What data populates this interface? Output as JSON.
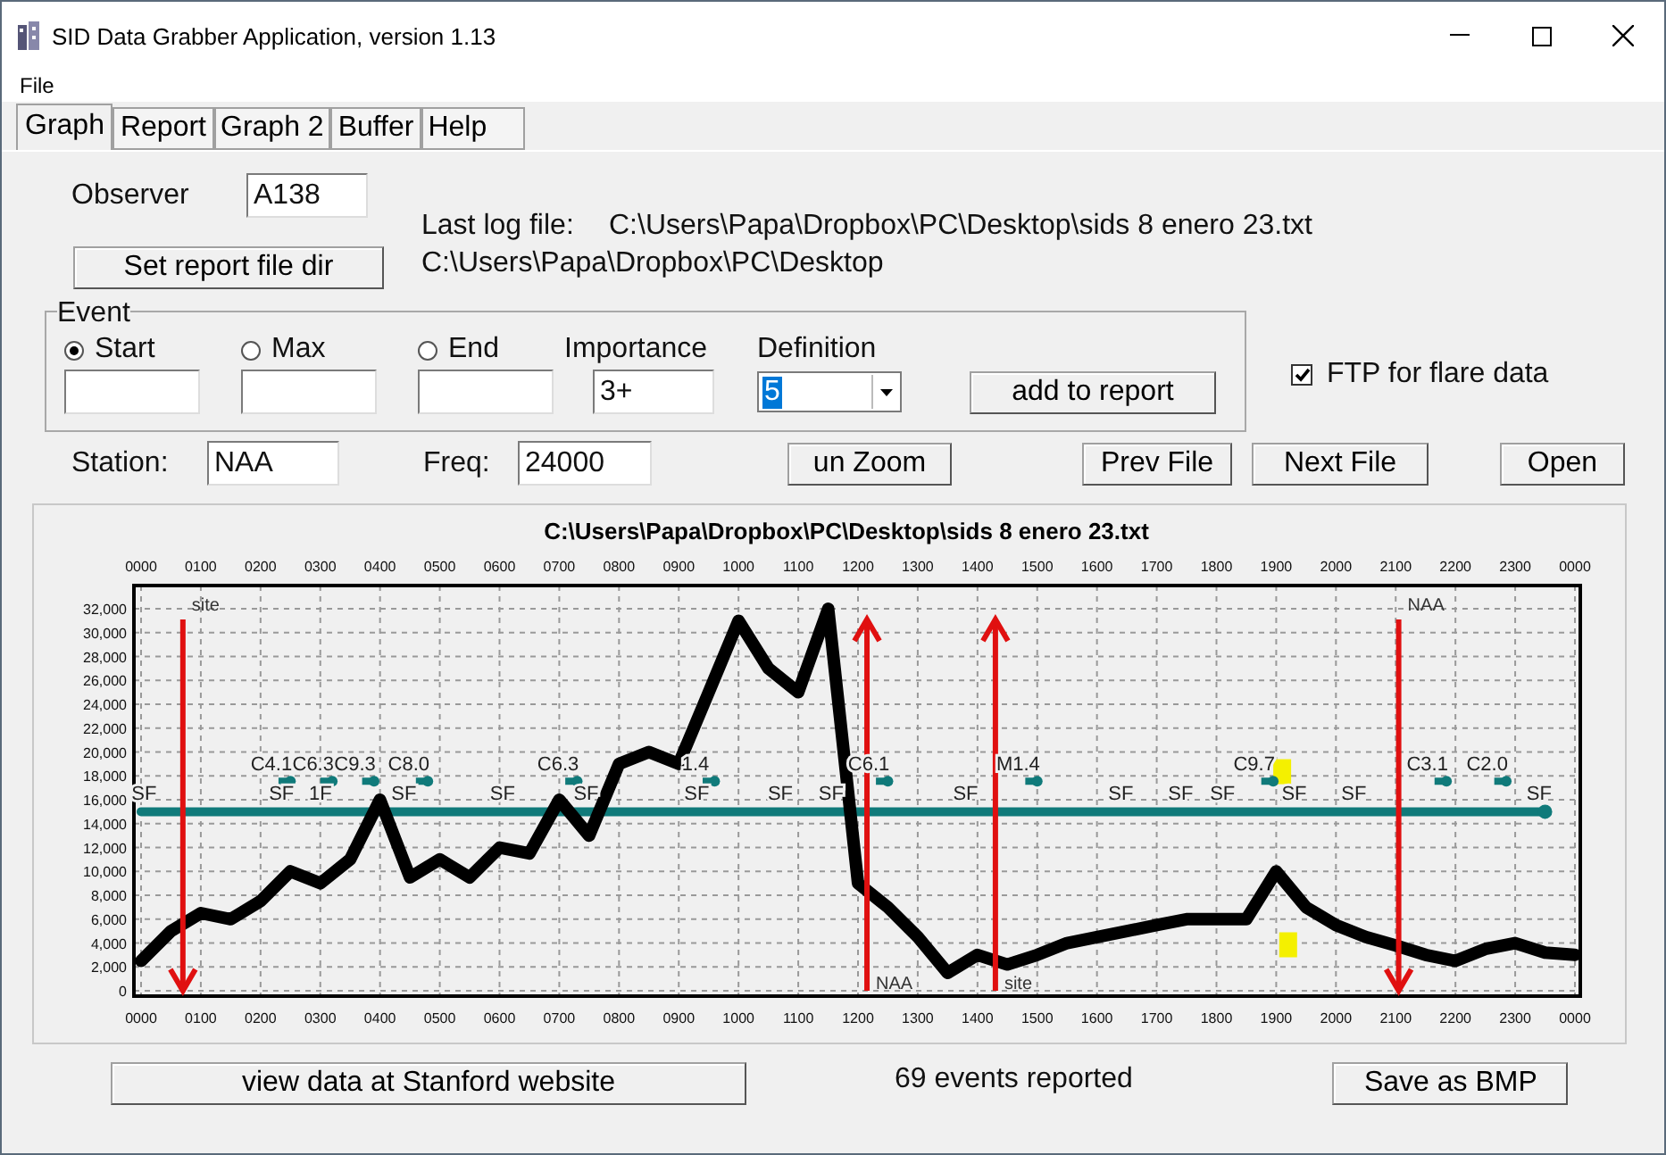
{
  "window": {
    "title": "SID Data Grabber Application, version 1.13"
  },
  "menu": [
    "File"
  ],
  "tabs": [
    {
      "label": "Graph",
      "selected": true
    },
    {
      "label": "Report",
      "selected": false
    },
    {
      "label": "Graph 2",
      "selected": false
    },
    {
      "label": "Buffer",
      "selected": false
    },
    {
      "label": "Help",
      "selected": false
    }
  ],
  "observer": {
    "label": "Observer",
    "value": "A138"
  },
  "last_log": {
    "label": "Last log file:",
    "path": "C:\\Users\\Papa\\Dropbox\\PC\\Desktop\\sids 8 enero 23.txt"
  },
  "report_dir": {
    "button": "Set report file dir",
    "path": "C:\\Users\\Papa\\Dropbox\\PC\\Desktop"
  },
  "event": {
    "legend": "Event",
    "options": [
      {
        "label": "Start",
        "selected": true
      },
      {
        "label": "Max",
        "selected": false
      },
      {
        "label": "End",
        "selected": false
      }
    ],
    "importance": {
      "label": "Importance",
      "value": "3+"
    },
    "definition": {
      "label": "Definition",
      "value": "5"
    },
    "add_button": "add to report"
  },
  "ftp": {
    "label": "FTP for flare data",
    "checked": true
  },
  "station": {
    "label": "Station:",
    "value": "NAA"
  },
  "freq": {
    "label": "Freq:",
    "value": "24000"
  },
  "buttons": [
    "un Zoom",
    "Prev File",
    "Next File",
    "Open"
  ],
  "chart": {
    "chart_data": {
      "type": "line",
      "title": "C:\\Users\\Papa\\Dropbox\\PC\\Desktop\\sids 8 enero 23.txt",
      "categories": [
        "0000",
        null,
        "0100",
        null,
        "0200",
        null,
        "0300",
        null,
        "0400",
        null,
        "0500",
        null,
        "0600",
        null,
        "0700",
        null,
        "0800",
        null,
        "0900",
        null,
        "1000",
        null,
        "1100",
        null,
        "1200",
        null,
        "1300",
        null,
        "1400",
        null,
        "1500",
        null,
        "1600",
        null,
        "1700",
        null,
        "1800",
        null,
        "1900",
        null,
        "2000",
        null,
        "2100",
        null,
        "2200",
        null,
        "2300",
        null,
        "0000"
      ],
      "series": [
        {
          "color": "#107a7a",
          "values": [
            15000,
            15000,
            15000,
            15000,
            15000,
            15000,
            15000,
            15000,
            15000,
            15000,
            15000,
            15000,
            15000,
            15000,
            15000,
            15000,
            15000,
            15000,
            15000,
            15000,
            15000,
            15000,
            15000,
            15000,
            15000,
            15000,
            15000,
            15000,
            15000,
            15000,
            15000,
            15000,
            15000,
            15000,
            15000,
            15000,
            15000,
            15000,
            15000,
            15000,
            15000,
            15000,
            15000,
            15000,
            15000,
            15000,
            15000,
            15000,
            null
          ]
        },
        {
          "color": "#000000",
          "values": [
            2500,
            5000,
            6500,
            6000,
            7500,
            10000,
            9000,
            11000,
            16000,
            9500,
            11000,
            9500,
            12000,
            11500,
            16000,
            13000,
            19000,
            20000,
            19000,
            25000,
            31000,
            27000,
            25000,
            32000,
            9000,
            7000,
            4500,
            1500,
            3000,
            2200,
            3000,
            4000,
            4500,
            5000,
            5500,
            6000,
            6000,
            6000,
            10000,
            7000,
            5500,
            4500,
            3800,
            3000,
            2500,
            3500,
            4000,
            3200,
            3000
          ]
        }
      ],
      "ylim": [
        0,
        32000
      ],
      "grid": true,
      "yticks": [
        {
          "value": 0,
          "label": "0"
        },
        {
          "value": 2000,
          "label": "2,000"
        },
        {
          "value": 4000,
          "label": "4,000"
        },
        {
          "value": 6000,
          "label": "6,000"
        },
        {
          "value": 8000,
          "label": "8,000"
        },
        {
          "value": 10000,
          "label": "10,000"
        },
        {
          "value": 12000,
          "label": "12,000"
        },
        {
          "value": 14000,
          "label": "14,000"
        },
        {
          "value": 16000,
          "label": "16,000"
        },
        {
          "value": 18000,
          "label": "18,000"
        },
        {
          "value": 20000,
          "label": "20,000"
        },
        {
          "value": 22000,
          "label": "22,000"
        },
        {
          "value": 24000,
          "label": "24,000"
        },
        {
          "value": 26000,
          "label": "26,000"
        },
        {
          "value": 28000,
          "label": "28,000"
        },
        {
          "value": 30000,
          "label": "30,000"
        },
        {
          "value": 32000,
          "label": "32,000"
        }
      ],
      "annotations": [
        "site",
        "NAA",
        "site",
        "NAA",
        "C4.1",
        "C6.3",
        "C9.3",
        "C8.0",
        "C6.3",
        "1.4",
        "C6.1",
        "M1.4",
        "C9.7",
        "C3.1",
        "C2.0",
        "SF",
        "SF",
        "1F",
        "SF",
        "SF",
        "SF",
        "SF",
        "SF",
        "SF",
        "SF",
        "SF",
        "SF",
        "SF",
        "SF",
        "SF",
        "SF"
      ]
    }
  },
  "footer": {
    "web_button": "view data at Stanford website",
    "status": "69 events reported",
    "save_button": "Save as BMP"
  }
}
